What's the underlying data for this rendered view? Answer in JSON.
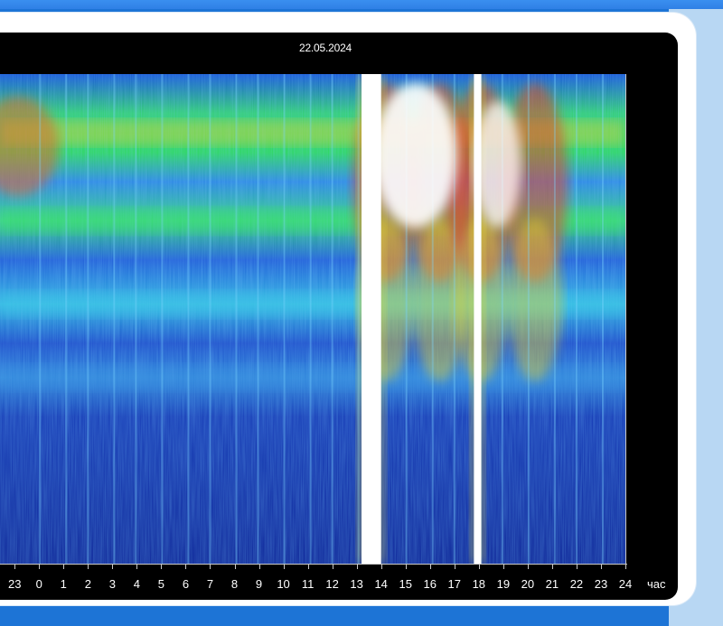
{
  "chart_data": {
    "type": "heatmap",
    "title": "22.05.2024",
    "xlabel": "час",
    "x_ticks": [
      "23",
      "0",
      "1",
      "2",
      "3",
      "4",
      "5",
      "6",
      "7",
      "8",
      "9",
      "10",
      "11",
      "12",
      "13",
      "14",
      "15",
      "16",
      "17",
      "18",
      "19",
      "20",
      "21",
      "22",
      "23",
      "24"
    ],
    "x_tick_values": [
      -1,
      0,
      1,
      2,
      3,
      4,
      5,
      6,
      7,
      8,
      9,
      10,
      11,
      12,
      13,
      14,
      15,
      16,
      17,
      18,
      19,
      20,
      21,
      22,
      23,
      24
    ],
    "xlim": [
      -1.6,
      24
    ],
    "grid": false,
    "colormap": [
      "#0b1f8f",
      "#1d4fd0",
      "#27b7e8",
      "#2ee05a",
      "#e8e02a",
      "#e0402a",
      "#ffffff"
    ],
    "horizontal_bands": [
      {
        "level_fraction": 0.12,
        "intensity": "green-yellow-red"
      },
      {
        "level_fraction": 0.3,
        "intensity": "green"
      },
      {
        "level_fraction": 0.47,
        "intensity": "cyan"
      },
      {
        "level_fraction": 0.62,
        "intensity": "light-blue"
      }
    ],
    "saturation_events": [
      {
        "start_hour": 13.2,
        "end_hour": 14.0,
        "color": "white"
      },
      {
        "start_hour": 17.8,
        "end_hour": 18.1,
        "color": "white"
      }
    ],
    "high_activity_hours": [
      14.2,
      16.4,
      18.1,
      20.3
    ]
  }
}
